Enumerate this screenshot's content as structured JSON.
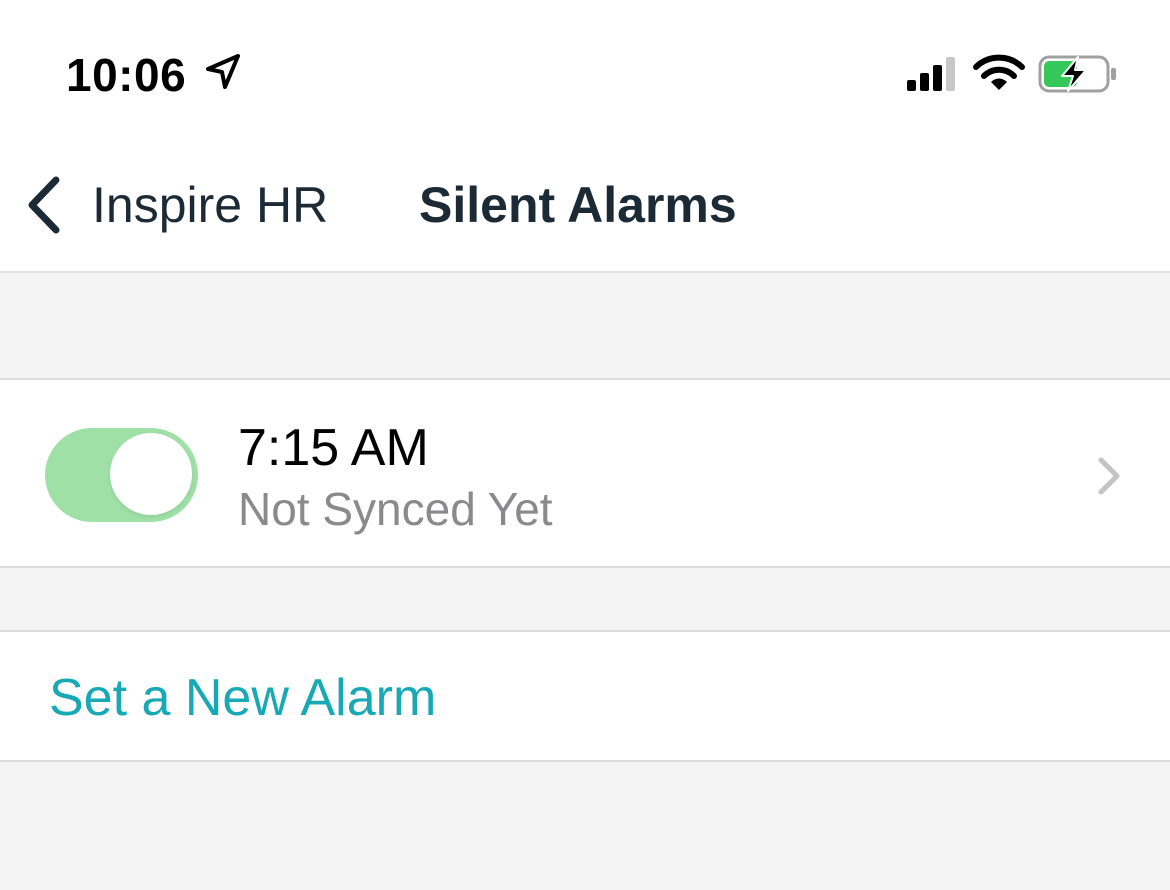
{
  "status_bar": {
    "time": "10:06",
    "icons": [
      "location-arrow-icon",
      "cellular-signal-icon",
      "wifi-icon",
      "battery-charging-icon"
    ],
    "battery_color": "#34c759"
  },
  "nav": {
    "back_label": "Inspire HR",
    "title": "Silent Alarms"
  },
  "alarms": [
    {
      "time": "7:15 AM",
      "status": "Not Synced Yet",
      "enabled": true,
      "toggle_color": "#9ee0a6"
    }
  ],
  "actions": {
    "new_alarm_label": "Set a New Alarm",
    "accent_color": "#17a9b5"
  }
}
